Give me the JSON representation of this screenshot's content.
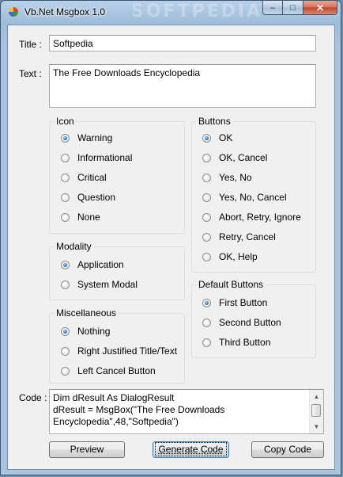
{
  "window": {
    "title": "Vb.Net Msgbox 1.0",
    "watermark": "SOFTPEDIA",
    "controls": {
      "minimize": "–",
      "maximize": "□",
      "close": "✕"
    }
  },
  "fields": {
    "title_label": "Title :",
    "title_value": "Softpedia",
    "text_label": "Text :",
    "text_value": "The Free Downloads Encyclopedia",
    "code_label": "Code :",
    "code_lines": [
      "Dim dResult As DialogResult",
      "dResult = MsgBox(\"The Free Downloads",
      "Encyclopedia\",48,\"Softpedia\")"
    ]
  },
  "icon_group": {
    "title": "Icon",
    "options": [
      "Warning",
      "Informational",
      "Critical",
      "Question",
      "None"
    ],
    "selected": "Warning"
  },
  "modality_group": {
    "title": "Modality",
    "options": [
      "Application",
      "System Modal"
    ],
    "selected": "Application"
  },
  "misc_group": {
    "title": "Miscellaneous",
    "options": [
      "Nothing",
      "Right Justified Title/Text",
      "Left Cancel Button"
    ],
    "selected": "Nothing"
  },
  "buttons_group": {
    "title": "Buttons",
    "options": [
      "OK",
      "OK, Cancel",
      "Yes, No",
      "Yes, No, Cancel",
      "Abort, Retry, Ignore",
      "Retry, Cancel",
      "OK, Help"
    ],
    "selected": "OK"
  },
  "default_buttons_group": {
    "title": "Default Buttons",
    "options": [
      "First Button",
      "Second Button",
      "Third Button"
    ],
    "selected": "First Button"
  },
  "actions": {
    "preview": "Preview",
    "generate": "Generate Code",
    "copy": "Copy Code"
  },
  "colors": {
    "accent": "#2a7cc4",
    "titlebar": "#b9d1ea",
    "close_button": "#c2472a"
  }
}
